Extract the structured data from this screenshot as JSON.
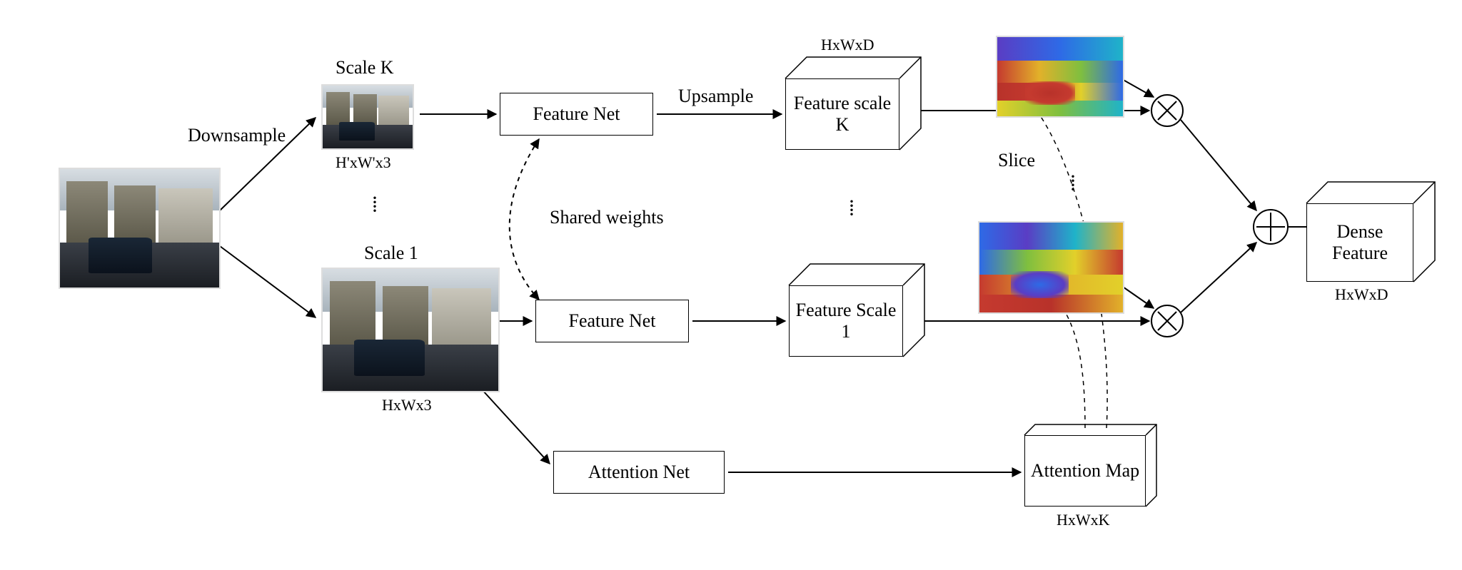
{
  "labels": {
    "downsample": "Downsample",
    "scale_k": "Scale K",
    "scale_1": "Scale 1",
    "dims_small": "H'xW'x3",
    "dims_full": "HxWx3",
    "dims_featK": "HxWxD",
    "dims_attn": "HxWxK",
    "dims_out": "HxWxD",
    "upsample": "Upsample",
    "shared": "Shared weights",
    "slice": "Slice"
  },
  "boxes": {
    "feature_net_a": "Feature Net",
    "feature_net_b": "Feature Net",
    "attention_net": "Attention Net",
    "feat_scale_k": "Feature scale K",
    "feat_scale_1": "Feature Scale 1",
    "attn_map": "Attention Map",
    "dense_feature": "Dense Feature"
  }
}
